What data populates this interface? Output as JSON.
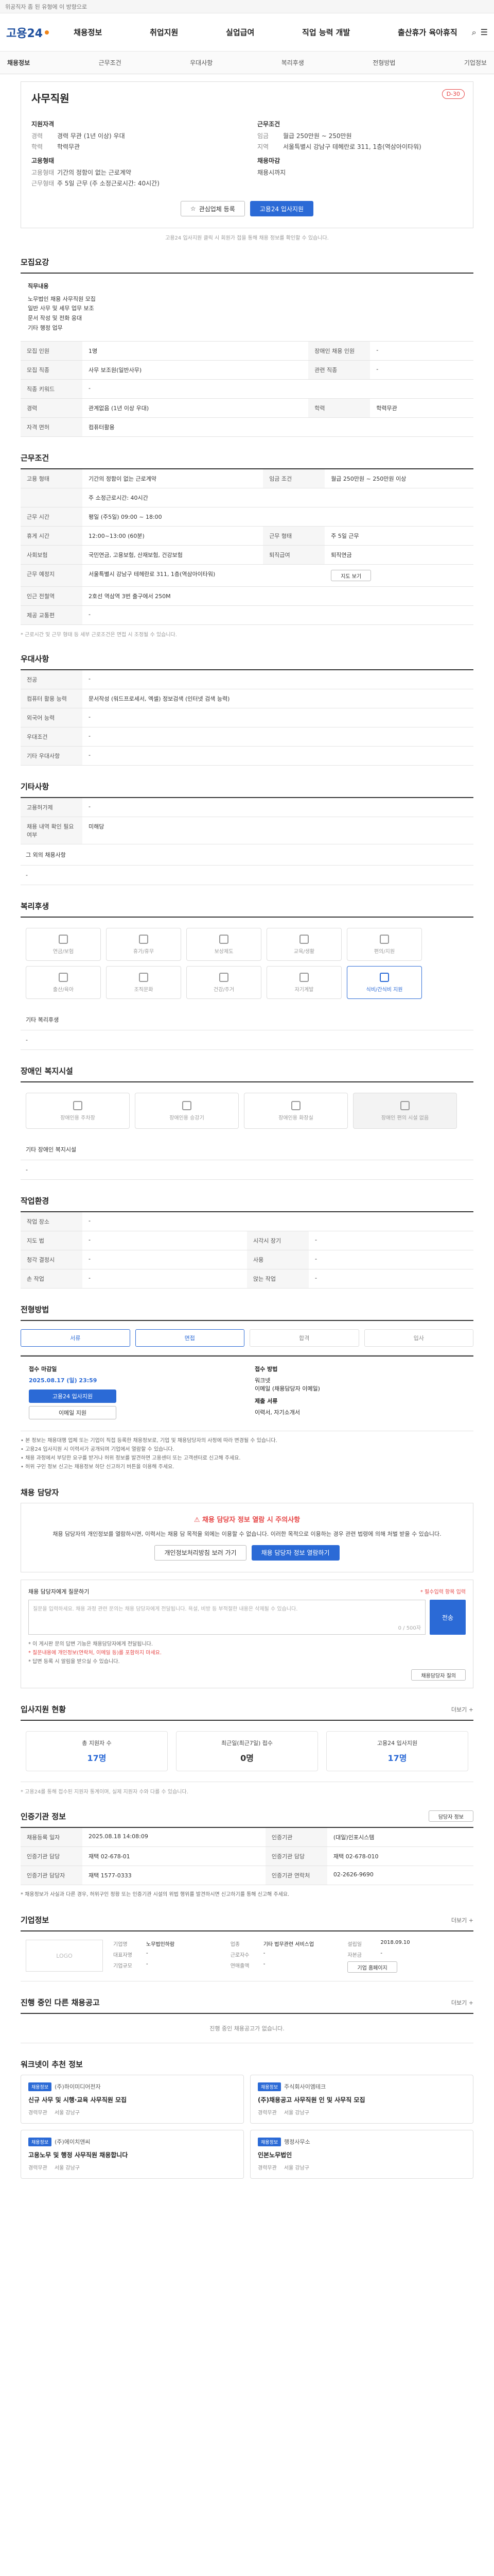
{
  "topbar": {
    "text": "위공직자 좀 된 유형에 이 방향으로"
  },
  "gnb": {
    "logo": "고용24",
    "menu": [
      "채용정보",
      "취업지원",
      "실업급여",
      "직업 능력 개발",
      "출산휴가 육아휴직"
    ],
    "icons": [
      "search-icon",
      "menu-icon"
    ]
  },
  "subnav": [
    "채용정보",
    "근무조건",
    "우대사항",
    "복리후생",
    "전형방법",
    "기업정보"
  ],
  "job": {
    "title": "사무직원",
    "dday": "D-30",
    "left_head": "지원자격",
    "left": [
      {
        "k": "경력",
        "v": "경력 무관 (1년 이상) 우대"
      },
      {
        "k": "학력",
        "v": "학력무관"
      }
    ],
    "right_head": "근무조건",
    "right": [
      {
        "k": "임금",
        "v": "월급 250만원 ~ 250만원"
      },
      {
        "k": "지역",
        "v": "서울특별시 강남구 테헤란로 311, 1층(역삼아이타워)"
      }
    ],
    "left_head2": "고용형태",
    "left2": [
      {
        "k": "고용형태",
        "v": "기간의 정함이 없는 근로계약"
      },
      {
        "k": "근무형태",
        "v": "주 5일 근무 (주 소정근로시간: 40시간)"
      }
    ],
    "right_head2": "채용마감",
    "right2": [
      {
        "k": "",
        "v": "채용시까지"
      }
    ],
    "btn_scrap": "관심업체 등록",
    "btn_apply": "고용24 입사지원",
    "note": "고용24 입사지원 클릭 시 회원가 접을 통해 채용 정보를 확인할 수 있습니다."
  },
  "duty": {
    "heading": "모집요강",
    "box_title": "직무내용",
    "lines": [
      "노무법인 채용 사무직원 모집",
      "일반 사무 및 세무 업무 보조",
      "문서 작성 및 전화 응대",
      "기타 행정 업무"
    ],
    "rows": [
      {
        "k": "모집 인원",
        "v": "1명",
        "k2": "장애인 채용 인원",
        "v2": "-"
      },
      {
        "k": "모집 직종",
        "v": "사무 보조원(일반사무)",
        "k2": "관련 직종",
        "v2": "-"
      },
      {
        "k": "직종 키워드",
        "v": "-",
        "k2": "",
        "v2": ""
      },
      {
        "k": "경력",
        "v": "관계없음 (1년 이상 우대)",
        "k2": "학력",
        "v2": "학력무관"
      },
      {
        "k": "자격 면허",
        "v": "컴퓨터활용",
        "k2": "",
        "v2": ""
      }
    ]
  },
  "work": {
    "heading": "근무조건",
    "rows": [
      {
        "k": "고용 형태",
        "v": "기간의 정함이 없는 근로계약",
        "k2": "임금 조건",
        "v2": "월급 250만원 ~ 250만원 이상"
      },
      {
        "k": "",
        "v": "주 소정근로시간: 40시간",
        "k2": "",
        "v2": ""
      },
      {
        "k": "근무 시간",
        "v": "평일 (주5일) 09:00 ~ 18:00",
        "k2": "",
        "v2": ""
      },
      {
        "k": "휴게 시간",
        "v": "12:00~13:00 (60분)",
        "k2": "근무 형태",
        "v2": "주 5일 근무"
      },
      {
        "k": "사회보험",
        "v": "국민연금, 고용보험, 산재보험, 건강보험",
        "k2": "퇴직급여",
        "v2": "퇴직연금"
      },
      {
        "k": "근무 예정지",
        "v": "서울특별시 강남구 테헤란로 311, 1층(역삼아이타워)",
        "k2": "",
        "v2": "지도 보기"
      },
      {
        "k": "인근 전철역",
        "v": "2호선 역삼역 3번 출구에서 250M",
        "k2": "",
        "v2": ""
      },
      {
        "k": "제공 교통편",
        "v": "-",
        "k2": "",
        "v2": ""
      }
    ],
    "note": "* 근로시간 및 근무 형태 등 세부 근로조건은 면접 시 조정될 수 있습니다."
  },
  "prefer": {
    "heading": "우대사항",
    "rows": [
      {
        "k": "전공",
        "v": "-"
      },
      {
        "k": "컴퓨터 활용 능력",
        "v": "문서작성 (워드프로세서, 엑셀) 정보검색 (인터넷 검색 능력)"
      },
      {
        "k": "외국어 능력",
        "v": "-"
      },
      {
        "k": "우대조건",
        "v": "-"
      },
      {
        "k": "기타 우대사항",
        "v": "-"
      }
    ]
  },
  "extra": {
    "heading": "기타사항",
    "rows": [
      {
        "k": "고용허가제",
        "v": "-"
      },
      {
        "k": "채용 내역 확인 필요 여부",
        "v": "미해당"
      }
    ],
    "sub": "그 외의 채용사항",
    "sub_v": "-"
  },
  "welfare": {
    "heading": "복리후생",
    "items": [
      "연금/보험",
      "휴가/휴무",
      "보상제도",
      "교육/생활",
      "편의/지원",
      "출산/육아",
      "조직문화",
      "건강/주거",
      "자기계발",
      "식비/간식비 지원"
    ],
    "sub": "기타 복리후생",
    "sub_v": "-"
  },
  "disability": {
    "heading": "장애인 복지시설",
    "items": [
      "장애인용 주차장",
      "장애인용 승강기",
      "장애인용 화장실",
      "장애인 편의 시설 없음"
    ],
    "sub": "기타 장애인 복지시설",
    "sub_v": "-"
  },
  "env": {
    "heading": "작업환경",
    "rows": [
      {
        "k": "작업 장소",
        "v": "-",
        "k2": "",
        "v2": ""
      },
      {
        "k": "지도 법",
        "v": "-",
        "k2": "시각시 장기",
        "v2": "-"
      },
      {
        "k": "청각 결정시",
        "v": "-",
        "k2": "사용",
        "v2": "-"
      },
      {
        "k": "손 작업",
        "v": "-",
        "k2": "앉는 작업",
        "v2": "-"
      }
    ]
  },
  "process": {
    "heading": "전형방법",
    "steps": [
      "서류",
      "면접",
      "합격",
      "입사"
    ]
  },
  "apply": {
    "heading": "접수 마감일",
    "date": "2025.08.17 (일) 23:59",
    "btn_apply": "고용24 입사지원",
    "btn_email": "이메일 지원",
    "method_head": "접수 방법",
    "method": [
      "워크넷",
      "이메일 (채용담당자 이메일)",
      "제출 서류",
      "이력서, 자기소개서"
    ],
    "notice": [
      "• 본 정보는 채용대행 업체 또는 기업이 직접 등록한 채용정보로, 기업 및 채용담당자의 사정에 따라 변경될 수 있습니다.",
      "• 고용24 입사지원 시 이력서가 공개되며 기업에서 열람할 수 있습니다.",
      "• 채용 과정에서 부당한 요구를 받거나 허위 정보를 발견하면 고용센터 또는 고객센터로 신고해 주세요.",
      "• 허위 구인 정보 신고는 채용정보 하단 신고하기 버튼을 이용해 주세요."
    ]
  },
  "contact": {
    "heading": "채용 담당자",
    "warn": "채용 담당자 정보 열람 시 주의사항",
    "text": "채용 담당자의 개인정보를 열람하시면, 이력서는 채용 담 목적을 외에는 이용할 수 없습니다. 이러한 목적으로 이용하는 경우 관련 법령에 의해 처벌 받을 수 있습니다.",
    "btn1": "개인정보처리방침 보러 가기",
    "btn2": "채용 담당자 정보 열람하기",
    "inq_title": "채용 담당자에게 질문하기",
    "inq_right": "* 필수입력 항목 입력",
    "inq_placeholder": "질문을 입력하세요. 채용 과정 관련 문의는 채용 담당자에게 전달됩니다. 욕설, 비방 등 부적절한 내용은 삭제될 수 있습니다.",
    "inq_count": "0 / 500자",
    "inq_btn": "전송",
    "inq_notes": [
      "* 이 게시판 문의 답변 기능은 채용담당자에게 전달됩니다.",
      "* 질문내용에 개인정보(연락처, 이메일 등)를 포함하지 마세요.",
      "* 답변 등록 시 알림을 받으실 수 있습니다."
    ],
    "inq_link": "채용담당자 질의"
  },
  "stats": {
    "heading": "입사지원 현황",
    "more": "더보기 +",
    "items": [
      {
        "k": "총 지원자 수",
        "v": "17명"
      },
      {
        "k": "최근일(최근7일) 접수",
        "v": "0명"
      },
      {
        "k": "고용24 입사지원",
        "v": "17명"
      }
    ],
    "note": "* 고용24를 통해 접수된 지원자 통계이며, 실제 지원자 수와 다를 수 있습니다."
  },
  "recruiter": {
    "heading": "인증기관 정보",
    "btn": "담당자 정보",
    "rows": [
      {
        "k": "채용등록 일자",
        "v": "2025.08.18 14:08:09",
        "k2": "인증기관",
        "v2": "(대일)인포시스템"
      },
      {
        "k": "인증기관 담당",
        "v": "재택 02-678-01",
        "k2": "인증기관 담당",
        "v2": "재택 02-678-010"
      },
      {
        "k": "인증기관 담당자",
        "v": "재택 1577-0333",
        "k2": "인증기관 연락처",
        "v2": "02-2626-9690"
      }
    ],
    "note": "* 채용정보가 사실과 다른 경우, 허위구인 정황 또는 인증기관 시설의 위법 행위를 발견하시면 신고하기를 통해 신고해 주세요."
  },
  "company": {
    "heading": "기업정보",
    "more": "더보기 +",
    "logo": "LOGO",
    "info": [
      {
        "k": "기업명",
        "v": "노무법인하람"
      },
      {
        "k": "업종",
        "v": "기타 법무관련 서비스업"
      },
      {
        "k": "설립일",
        "v": "2018.09.10"
      },
      {
        "k": "대표자명",
        "v": "-"
      },
      {
        "k": "근로자수",
        "v": "-"
      },
      {
        "k": "자본금",
        "v": "-"
      },
      {
        "k": "기업규모",
        "v": "-"
      },
      {
        "k": "연매출액",
        "v": "-"
      },
      {
        "k": "",
        "v": ""
      }
    ],
    "btn": "기업 홈페이지"
  },
  "others": {
    "heading": "진행 중인 다른 채용공고",
    "more": "더보기 +",
    "empty": "진행 중인 채용공고가 없습니다."
  },
  "recommend": {
    "heading": "워크넷이 추천 정보",
    "items": [
      {
        "tag": "채용정보",
        "co": "(주)하이미디어전자",
        "t": "신규 사무 및 시행·교육 사무직원 모집",
        "m1": "경력무관",
        "m2": "서울 강남구"
      },
      {
        "tag": "채용정보",
        "co": "주식회사이엠테크",
        "t": "(주)채용공고 사무직원 인 및 사무직 모집",
        "m1": "경력무관",
        "m2": "서울 강남구"
      },
      {
        "tag": "채용정보",
        "co": "(주)에이치앤씨",
        "t": "고용노무 및 행정 사무직원 채용합니다",
        "m1": "경력무관",
        "m2": "서울 강남구"
      },
      {
        "tag": "채용정보",
        "co": "행정사무소",
        "t": "인본노무법인",
        "m1": "경력무관",
        "m2": "서울 강남구"
      }
    ]
  }
}
